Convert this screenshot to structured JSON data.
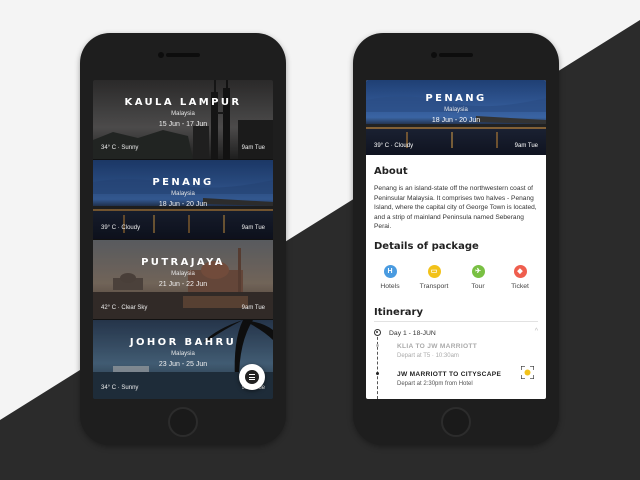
{
  "colors": {
    "accent_yellow": "#f2c21a",
    "hotels_blue": "#4a9be0",
    "transport_yellow": "#f2c21a",
    "tour_green": "#79c043",
    "ticket_red": "#ef5e4e"
  },
  "left_screen": {
    "cards": [
      {
        "city": "KAULA LAMPUR",
        "country": "Malaysia",
        "dates": "15 Jun - 17 Jun",
        "weather": "34° C · Sunny",
        "time": "9am Tue"
      },
      {
        "city": "PENANG",
        "country": "Malaysia",
        "dates": "18 Jun - 20 Jun",
        "weather": "39° C · Cloudy",
        "time": "9am Tue"
      },
      {
        "city": "PUTRAJAYA",
        "country": "Malaysia",
        "dates": "21 Jun - 22 Jun",
        "weather": "42° C · Clear Sky",
        "time": "9am Tue"
      },
      {
        "city": "JOHOR BAHRU",
        "country": "Malaysia",
        "dates": "23 Jun - 25 Jun",
        "weather": "34° C · Sunny",
        "time": "9am Tue"
      }
    ],
    "menu_icon": "menu-icon"
  },
  "right_screen": {
    "hero": {
      "city": "PENANG",
      "country": "Malaysia",
      "dates": "18 Jun - 20 Jun",
      "weather": "39° C · Cloudy",
      "time": "9am Tue"
    },
    "about": {
      "title": "About",
      "text": "Penang is an island-state off the northwestern coast of Peninsular Malaysia. It comprises two halves - Penang Island, where the capital city of George Town is located, and a strip of mainland Peninsula named Seberang Perai."
    },
    "package": {
      "title": "Details of package",
      "items": [
        {
          "label": "Hotels",
          "icon": "hotel-icon",
          "glyph": "H"
        },
        {
          "label": "Transport",
          "icon": "taxi-icon",
          "glyph": "▭"
        },
        {
          "label": "Tour",
          "icon": "plane-icon",
          "glyph": "✈"
        },
        {
          "label": "Ticket",
          "icon": "ticket-icon",
          "glyph": "◆"
        }
      ]
    },
    "itinerary": {
      "title": "Itinerary",
      "day_label": "Day 1 - 18-JUN",
      "items": [
        {
          "title": "KLIA TO JW MARRIOTT",
          "subtitle": "Depart at T5 · 10:30am",
          "status": "done"
        },
        {
          "title": "JW MARRIOTT TO CITYSCAPE",
          "subtitle": "Depart at 2:30pm from Hotel",
          "status": "upcoming"
        }
      ]
    }
  }
}
